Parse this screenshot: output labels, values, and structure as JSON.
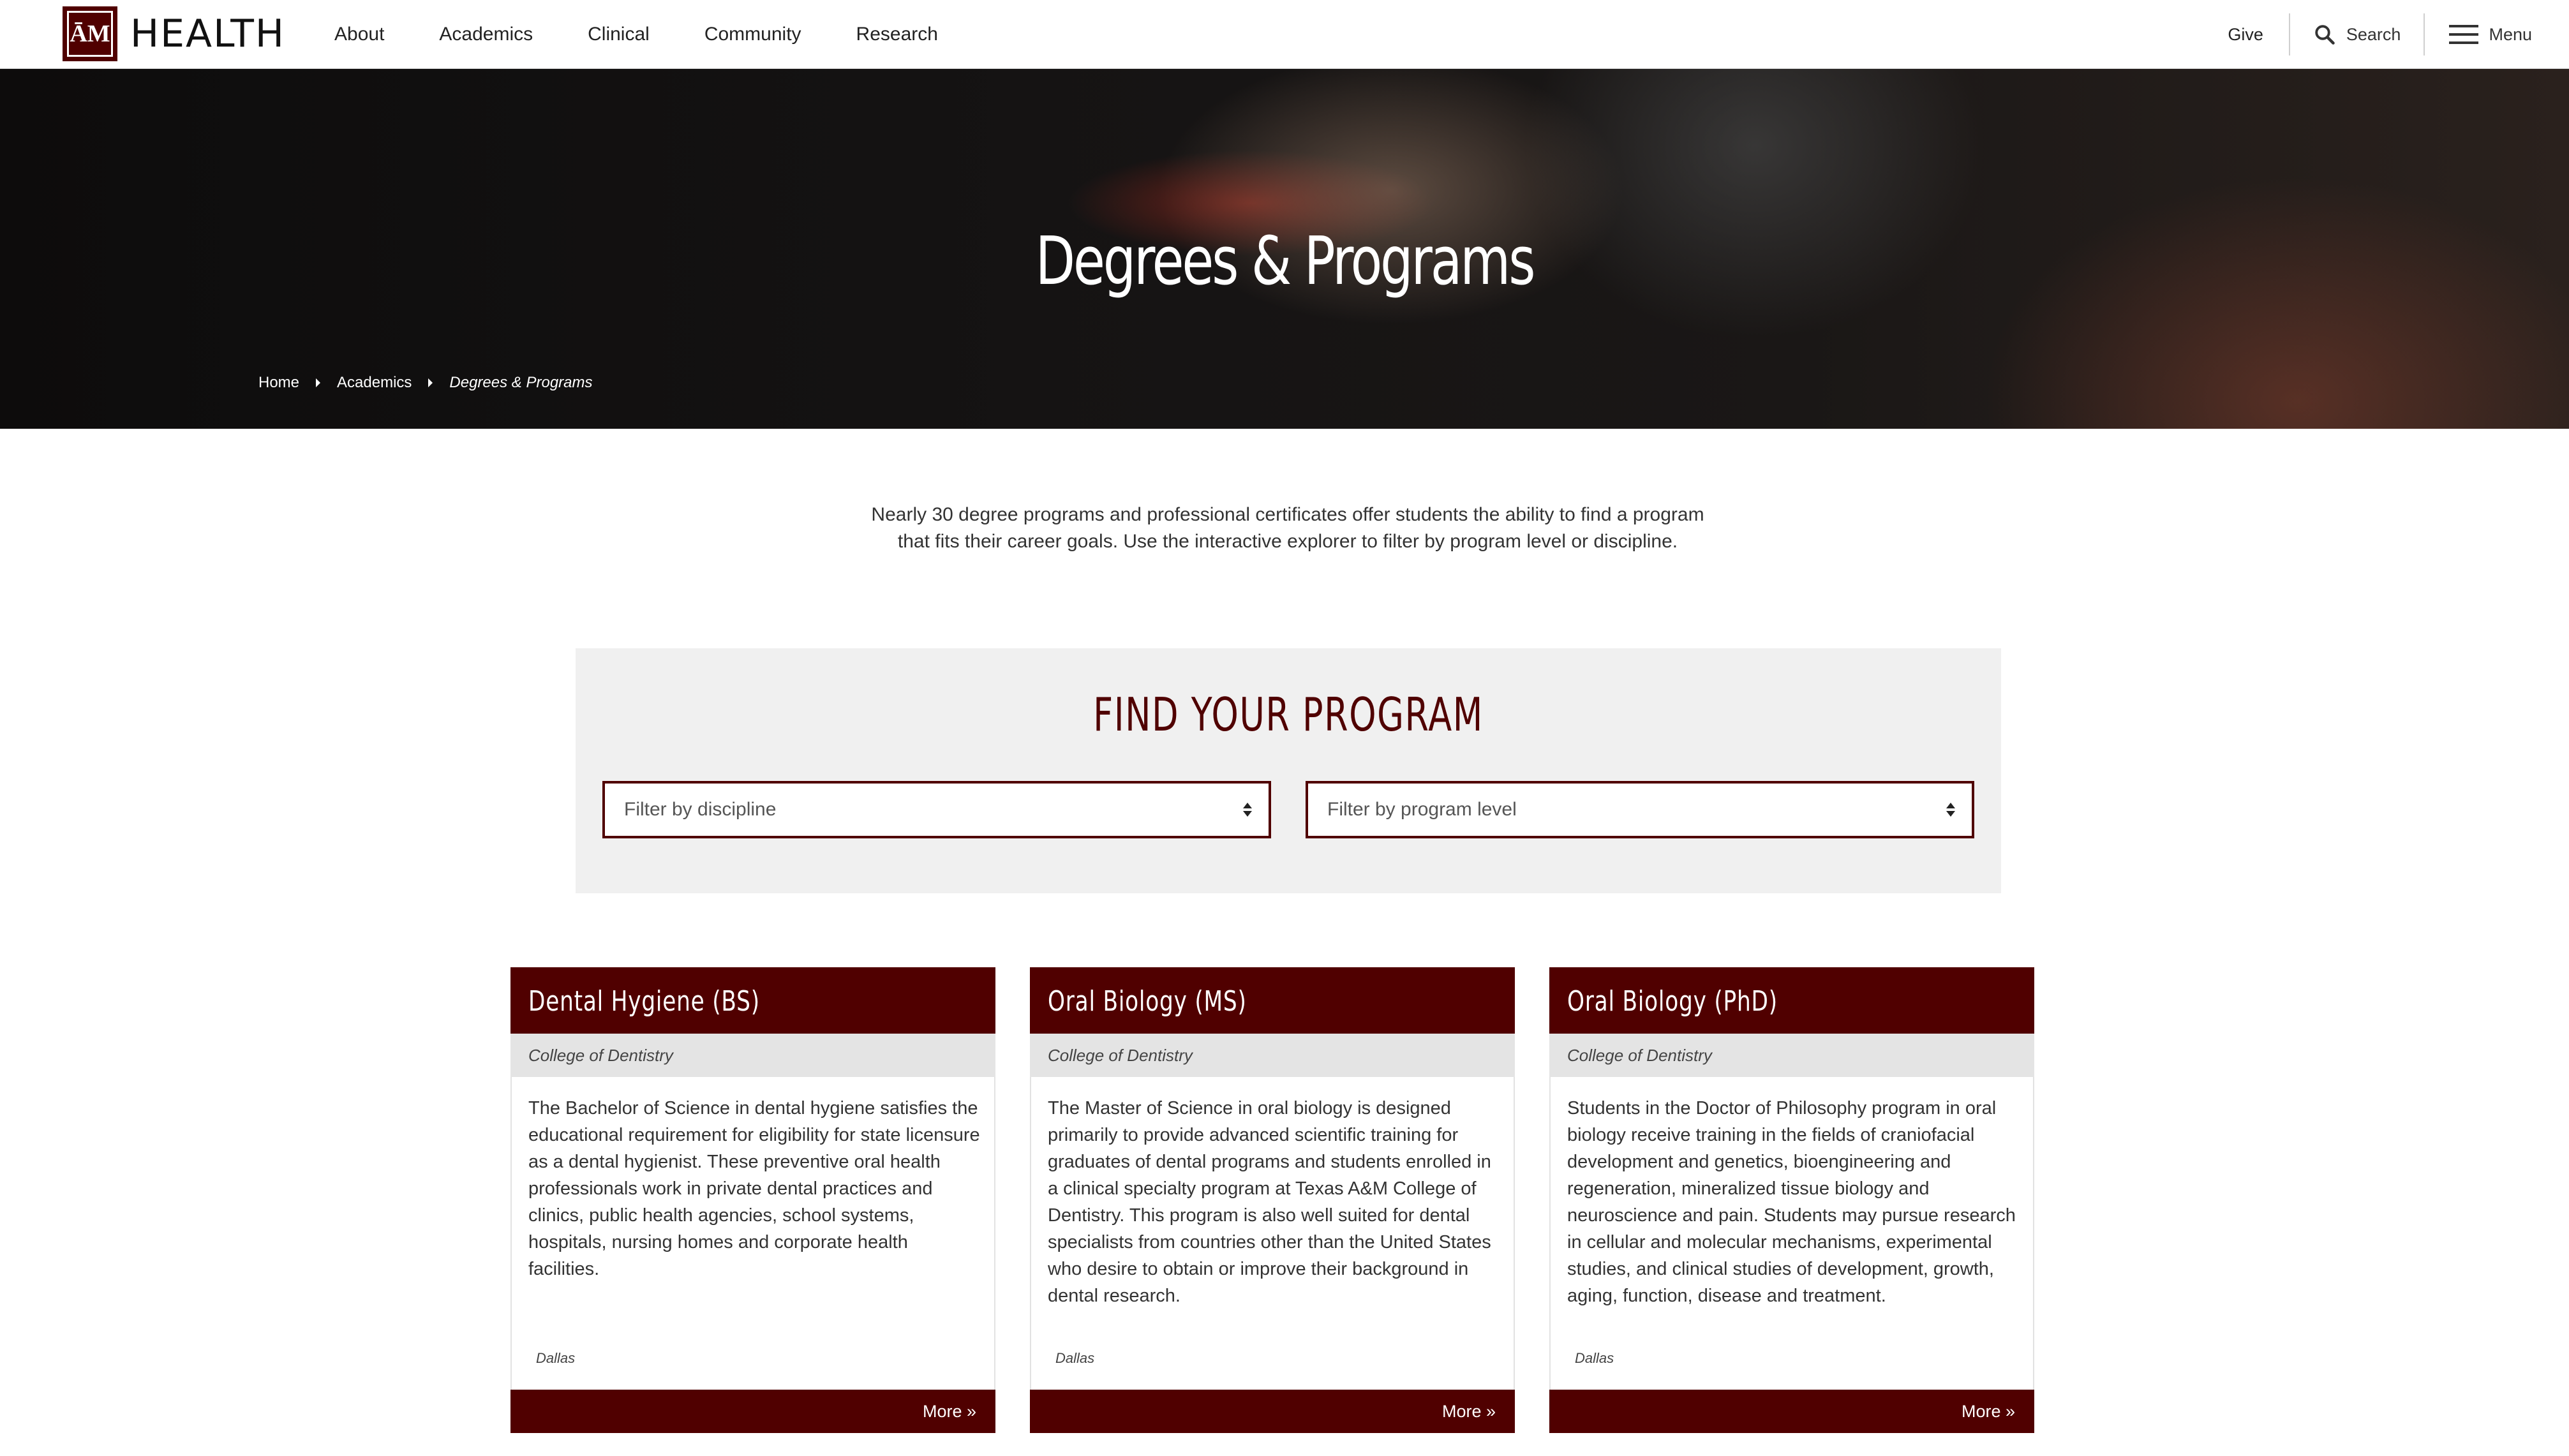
{
  "header": {
    "logo_mark": "ĀM",
    "logo_text": "HEALTH",
    "nav": [
      "About",
      "Academics",
      "Clinical",
      "Community",
      "Research"
    ],
    "give": "Give",
    "search": "Search",
    "menu": "Menu"
  },
  "hero": {
    "title": "Degrees & Programs",
    "breadcrumbs": [
      "Home",
      "Academics",
      "Degrees & Programs"
    ]
  },
  "intro": {
    "line1": "Nearly 30 degree programs and professional certificates offer students the ability to find a program",
    "line2": "that fits their career goals. Use the interactive explorer to filter by program level or discipline."
  },
  "finder": {
    "title": "FIND YOUR PROGRAM",
    "discipline_placeholder": "Filter by discipline",
    "level_placeholder": "Filter by program level"
  },
  "programs": [
    {
      "title": "Dental Hygiene (BS)",
      "college": "College of Dentistry",
      "description": "The Bachelor of Science in dental hygiene satisfies the educational requirement for eligibility for state licensure as a dental hygienist. These preventive oral health professionals work in private dental practices and clinics, public health agencies, school systems, hospitals, nursing homes and corporate health facilities.",
      "location": "Dallas",
      "more": "More »"
    },
    {
      "title": "Oral Biology (MS)",
      "college": "College of Dentistry",
      "description": "The Master of Science in oral biology is designed primarily to provide advanced scientific training for graduates of dental programs and students enrolled in a clinical specialty program at Texas A&M College of Dentistry. This program is also well suited for dental specialists from countries other than the United States who desire to obtain or improve their background in dental research.",
      "location": "Dallas",
      "more": "More »"
    },
    {
      "title": "Oral Biology (PhD)",
      "college": "College of Dentistry",
      "description": "Students in the Doctor of Philosophy program in oral biology receive training in the fields of craniofacial development and genetics, bioengineering and regeneration, mineralized tissue biology and neuroscience and pain. Students may pursue research in cellular and molecular mechanisms, experimental studies, and clinical studies of development, growth, aging, function, disease and treatment.",
      "location": "Dallas",
      "more": "More »"
    }
  ],
  "colors": {
    "maroon": "#500000",
    "panel_gray": "#f0f0f0",
    "college_band": "#e4e4e4"
  }
}
